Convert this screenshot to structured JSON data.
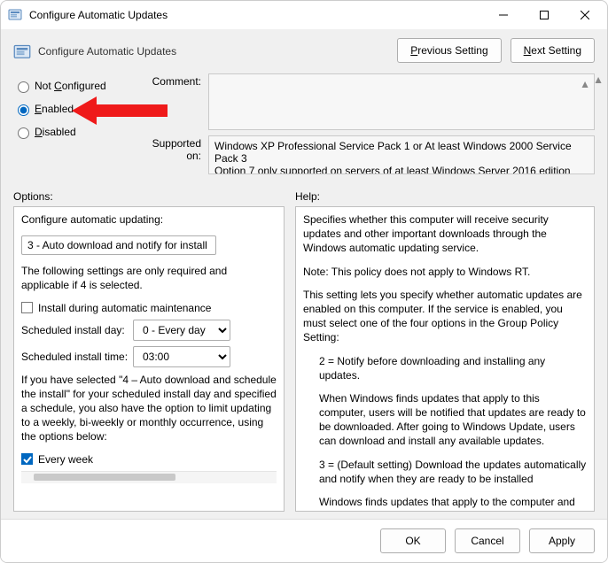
{
  "window": {
    "title": "Configure Automatic Updates"
  },
  "header": {
    "title": "Configure Automatic Updates",
    "prev": "Previous Setting",
    "next": "Next Setting",
    "prev_ul": "P",
    "next_ul": "N"
  },
  "radios": {
    "not_configured": "Not Configured",
    "not_ul": "C",
    "enabled": "Enabled",
    "enabled_ul": "E",
    "disabled": "Disabled",
    "disabled_ul": "D",
    "selected": "enabled"
  },
  "comment": {
    "label": "Comment:",
    "value": ""
  },
  "supported": {
    "label": "Supported on:",
    "text": "Windows XP Professional Service Pack 1 or At least Windows 2000 Service Pack 3\nOption 7 only supported on servers of at least Windows Server 2016 edition"
  },
  "sections": {
    "options": "Options:",
    "help": "Help:"
  },
  "options": {
    "cfg_label": "Configure automatic updating:",
    "cfg_value": "3 - Auto download and notify for install",
    "note": "The following settings are only required and applicable if 4 is selected.",
    "install_maint": "Install during automatic maintenance",
    "install_maint_checked": false,
    "day_label": "Scheduled install day:",
    "day_value": "0 - Every day",
    "time_label": "Scheduled install time:",
    "time_value": "03:00",
    "sched_note": "If you have selected \"4 – Auto download and schedule the install\" for your scheduled install day and specified a schedule, you also have the option to limit updating to a weekly, bi-weekly or monthly occurrence, using the options below:",
    "every_week": "Every week",
    "every_week_checked": true
  },
  "help": {
    "p1": "Specifies whether this computer will receive security updates and other important downloads through the Windows automatic updating service.",
    "p2": "Note: This policy does not apply to Windows RT.",
    "p3": "This setting lets you specify whether automatic updates are enabled on this computer. If the service is enabled, you must select one of the four options in the Group Policy Setting:",
    "p4": "2 = Notify before downloading and installing any updates.",
    "p5": "When Windows finds updates that apply to this computer, users will be notified that updates are ready to be downloaded. After going to Windows Update, users can download and install any available updates.",
    "p6": "3 = (Default setting) Download the updates automatically and notify when they are ready to be installed",
    "p7": "Windows finds updates that apply to the computer and"
  },
  "footer": {
    "ok": "OK",
    "cancel": "Cancel",
    "apply": "Apply"
  }
}
